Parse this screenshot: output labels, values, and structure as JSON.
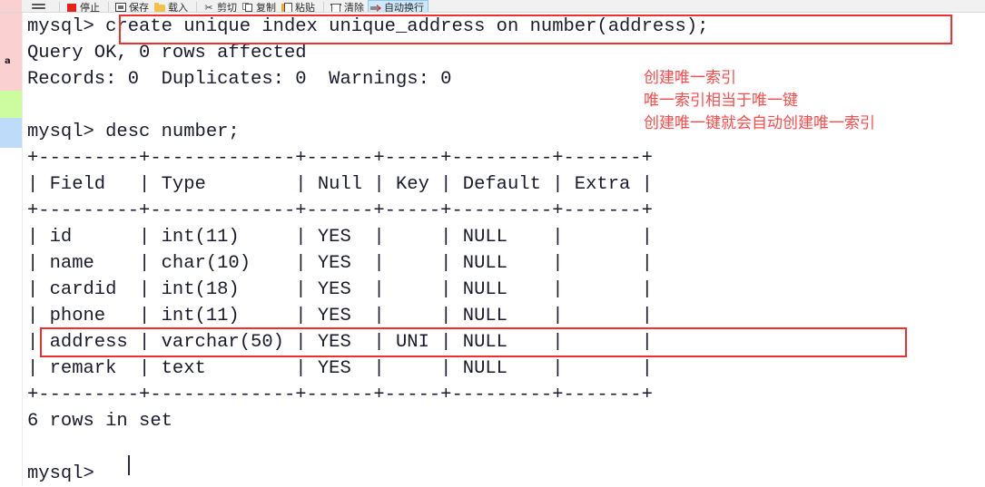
{
  "toolbar": {
    "menu_icon": "hamburger-icon",
    "items": [
      {
        "label": "停止",
        "icon": "stop-icon",
        "active": false
      },
      {
        "label": "保存",
        "icon": "save-icon",
        "active": false
      },
      {
        "label": "载入",
        "icon": "load-folder-icon",
        "active": false
      },
      {
        "label": "剪切",
        "icon": "scissors-icon",
        "active": false
      },
      {
        "label": "复制",
        "icon": "copy-icon",
        "active": false
      },
      {
        "label": "粘贴",
        "icon": "paste-icon",
        "active": false
      },
      {
        "label": "清除",
        "icon": "trash-icon",
        "active": false
      },
      {
        "label": "自动换行",
        "icon": "word-wrap-icon",
        "active": true
      }
    ],
    "scissors_glyph": "✂"
  },
  "gutter": {
    "mark": "a",
    "bands": [
      {
        "name": "pink-band",
        "color": "#fbd0d0"
      },
      {
        "name": "green-band",
        "color": "#cdfb9f"
      },
      {
        "name": "blue-band",
        "color": "#bfdbfa"
      }
    ]
  },
  "console": {
    "lines": [
      "mysql> create unique index unique_address on number(address);",
      "Query OK, 0 rows affected",
      "Records: 0  Duplicates: 0  Warnings: 0",
      "",
      "mysql> desc number;",
      "+---------+-------------+------+-----+---------+-------+",
      "| Field   | Type        | Null | Key | Default | Extra |",
      "+---------+-------------+------+-----+---------+-------+",
      "| id      | int(11)     | YES  |     | NULL    |       |",
      "| name    | char(10)    | YES  |     | NULL    |       |",
      "| cardid  | int(18)     | YES  |     | NULL    |       |",
      "| phone   | int(11)     | YES  |     | NULL    |       |",
      "| address | varchar(50) | YES  | UNI | NULL    |       |",
      "| remark  | text        | YES  |     | NULL    |       |",
      "+---------+-------------+------+-----+---------+-------+",
      "6 rows in set",
      "",
      "mysql> "
    ],
    "prompt": "mysql>",
    "command": "create unique index unique_address on number(address);",
    "result_status": "Query OK, 0 rows affected",
    "result_counts": "Records: 0  Duplicates: 0  Warnings: 0",
    "desc_command": "desc number;",
    "row_count_text": "6 rows in set"
  },
  "table": {
    "headers": [
      "Field",
      "Type",
      "Null",
      "Key",
      "Default",
      "Extra"
    ],
    "rows": [
      {
        "Field": "id",
        "Type": "int(11)",
        "Null": "YES",
        "Key": "",
        "Default": "NULL",
        "Extra": ""
      },
      {
        "Field": "name",
        "Type": "char(10)",
        "Null": "YES",
        "Key": "",
        "Default": "NULL",
        "Extra": ""
      },
      {
        "Field": "cardid",
        "Type": "int(18)",
        "Null": "YES",
        "Key": "",
        "Default": "NULL",
        "Extra": ""
      },
      {
        "Field": "phone",
        "Type": "int(11)",
        "Null": "YES",
        "Key": "",
        "Default": "NULL",
        "Extra": ""
      },
      {
        "Field": "address",
        "Type": "varchar(50)",
        "Null": "YES",
        "Key": "UNI",
        "Default": "NULL",
        "Extra": ""
      },
      {
        "Field": "remark",
        "Type": "text",
        "Null": "YES",
        "Key": "",
        "Default": "NULL",
        "Extra": ""
      }
    ]
  },
  "annotations": {
    "color": "#fb4a4a",
    "lines": [
      "创建唯一索引",
      "唯一索引相当于唯一键",
      "创建唯一键就会自动创建唯一索引"
    ],
    "highlight_boxes": [
      {
        "name": "command-highlight",
        "target": "create unique index unique_address on number(address);"
      },
      {
        "name": "address-row-highlight",
        "target": "| address | varchar(50) | YES  | UNI | NULL    |       |"
      }
    ]
  }
}
